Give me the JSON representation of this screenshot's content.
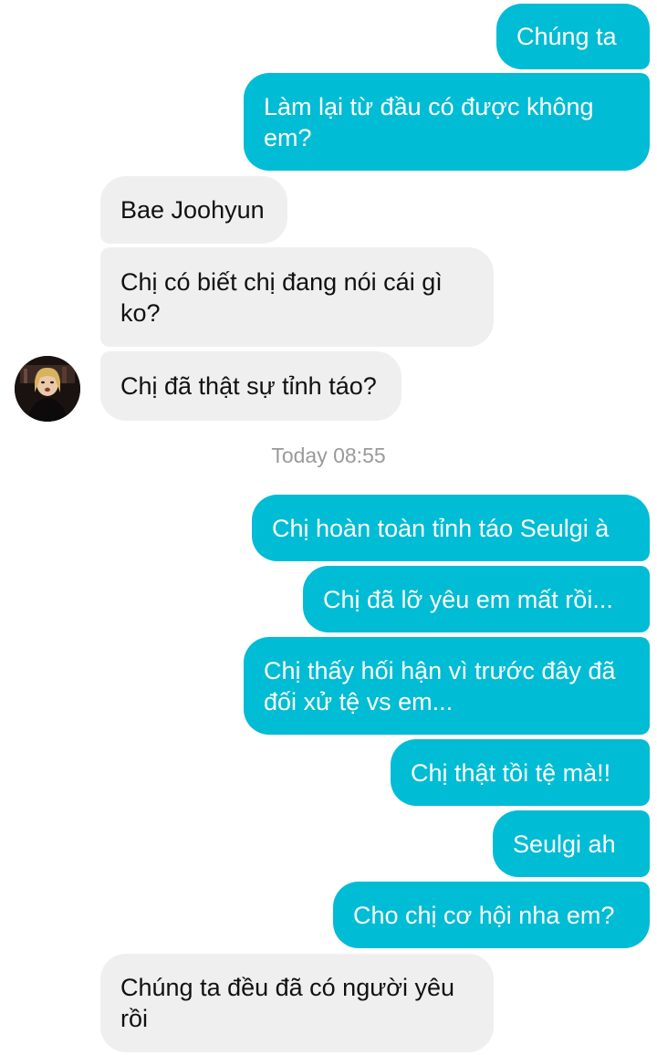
{
  "conversation": {
    "timestamp": "Today 08:55",
    "contact_avatar": "contact-avatar-photo",
    "messages": [
      {
        "dir": "sent",
        "text": "Chúng ta"
      },
      {
        "dir": "sent",
        "text": "Làm lại từ đầu có được không em?"
      },
      {
        "dir": "received",
        "text": "Bae Joohyun"
      },
      {
        "dir": "received",
        "text": "Chị có biết chị đang nói cái gì ko?"
      },
      {
        "dir": "received",
        "text": "Chị đã thật sự tỉnh táo?"
      },
      {
        "dir": "sent",
        "text": "Chị hoàn toàn tỉnh táo Seulgi à"
      },
      {
        "dir": "sent",
        "text": "Chị đã lỡ yêu em mất rồi..."
      },
      {
        "dir": "sent",
        "text": "Chị thấy hối hận vì trước đây đã đối xử tệ vs em..."
      },
      {
        "dir": "sent",
        "text": "Chị thật tồi tệ mà!!"
      },
      {
        "dir": "sent",
        "text": "Seulgi ah"
      },
      {
        "dir": "sent",
        "text": "Cho chị cơ hội nha em?"
      },
      {
        "dir": "received",
        "text": "Chúng ta đều đã có người yêu rồi"
      }
    ],
    "colors": {
      "sent_bubble": "#00bcd4",
      "received_bubble": "#efefef",
      "timestamp_text": "#9a9a9a"
    }
  }
}
